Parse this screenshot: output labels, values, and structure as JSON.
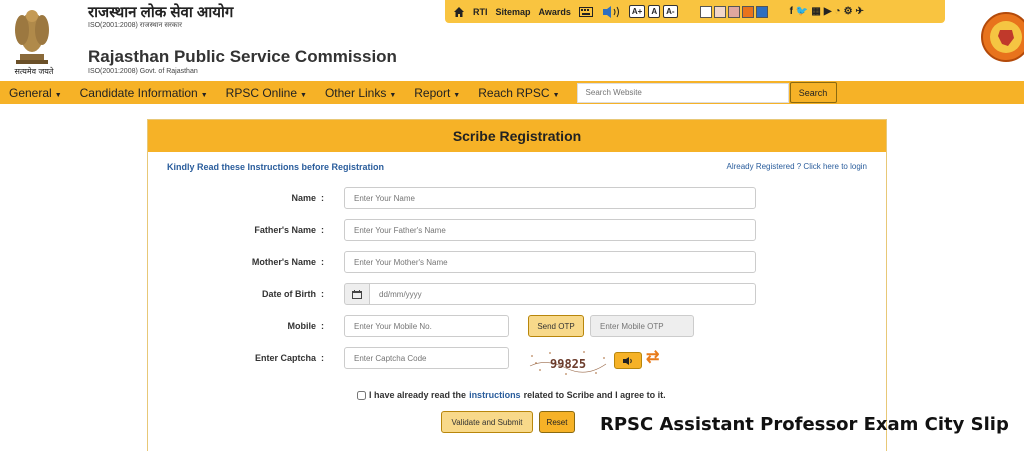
{
  "header": {
    "hindi_title": "राजस्थान लोक सेवा आयोग",
    "hindi_iso": "ISO(2001:2008) राजस्थान सरकार",
    "english_title": "Rajasthan Public Service Commission",
    "english_iso": "ISO(2001:2008) Govt. of Rajasthan",
    "emblem_motto": "सत्यमेव जयते"
  },
  "topbar": {
    "links": [
      "RTI",
      "Sitemap",
      "Awards"
    ],
    "font_buttons": [
      "A+",
      "A",
      "A-"
    ],
    "swatch_colors": [
      "#ffffff",
      "#f2d6c9",
      "#e0a7a0",
      "#e8731c",
      "#2e6fc0"
    ],
    "social_icons": [
      "facebook-icon",
      "twitter-icon",
      "calendar-icon",
      "youtube-icon",
      "rss-icon",
      "settings-icon",
      "pin-icon"
    ]
  },
  "nav": {
    "items": [
      "General",
      "Candidate Information",
      "RPSC Online",
      "Other Links",
      "Report",
      "Reach RPSC"
    ],
    "search_placeholder": "Search Website",
    "search_button": "Search"
  },
  "form": {
    "title": "Scribe Registration",
    "instructions_link": "Kindly Read these Instructions before Registration",
    "login_link": "Already Registered ? Click here to login",
    "fields": {
      "name": {
        "label": "Name",
        "placeholder": "Enter Your Name"
      },
      "father": {
        "label": "Father's Name",
        "placeholder": "Enter Your Father's Name"
      },
      "mother": {
        "label": "Mother's Name",
        "placeholder": "Enter Your Mother's Name"
      },
      "dob": {
        "label": "Date of Birth",
        "placeholder": "dd/mm/yyyy"
      },
      "mobile": {
        "label": "Mobile",
        "placeholder": "Enter Your Mobile No."
      },
      "otp": {
        "placeholder": "Enter Mobile OTP"
      },
      "captcha": {
        "label": "Enter Captcha",
        "placeholder": "Enter Captcha Code"
      }
    },
    "colon": ":",
    "send_otp": "Send OTP",
    "captcha_text": "99825",
    "agree_prefix": "I have already read the",
    "agree_link": "instructions",
    "agree_suffix": "related to Scribe and I agree to it.",
    "submit": "Validate and Submit",
    "reset": "Reset"
  },
  "watermark": "RPSC Assistant Professor Exam City Slip",
  "colors": {
    "accent": "#f6b227",
    "link": "#2a5d9c"
  }
}
